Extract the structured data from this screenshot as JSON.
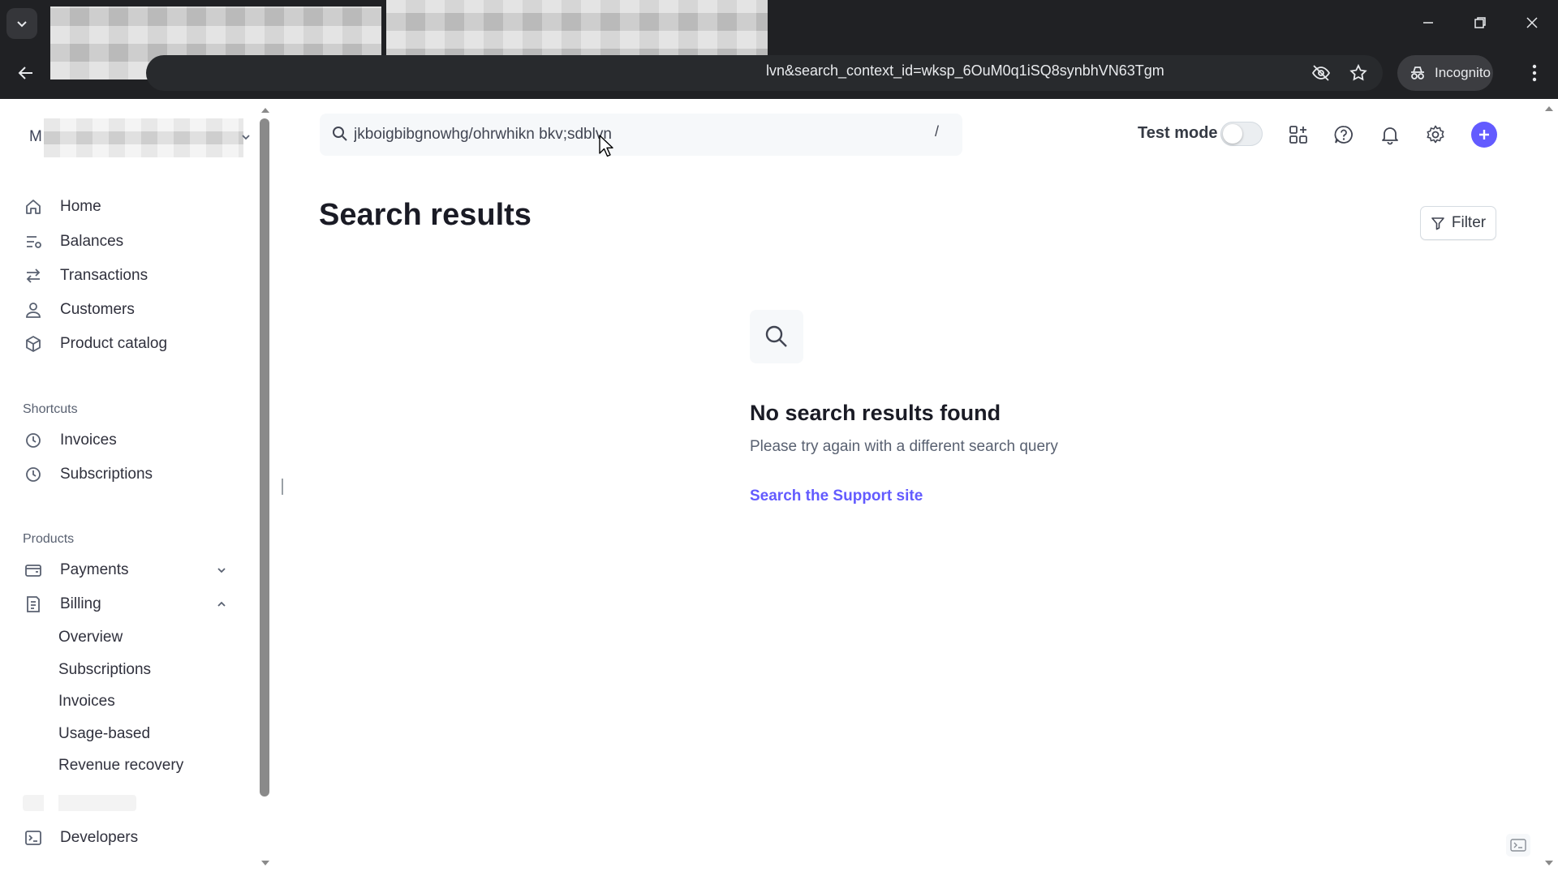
{
  "browser": {
    "url_visible": "lvn&search_context_id=wksp_6OuM0q1iSQ8synbhVN63Tgm",
    "incognito_label": "Incognito"
  },
  "account": {
    "initial": "M"
  },
  "sidebar": {
    "primary": [
      {
        "label": "Home",
        "icon": "home-icon"
      },
      {
        "label": "Balances",
        "icon": "balances-icon"
      },
      {
        "label": "Transactions",
        "icon": "transactions-icon"
      },
      {
        "label": "Customers",
        "icon": "customers-icon"
      },
      {
        "label": "Product catalog",
        "icon": "product-catalog-icon"
      }
    ],
    "shortcuts_label": "Shortcuts",
    "shortcuts": [
      {
        "label": "Invoices",
        "icon": "clock-icon"
      },
      {
        "label": "Subscriptions",
        "icon": "clock-icon"
      }
    ],
    "products_label": "Products",
    "payments_label": "Payments",
    "billing_label": "Billing",
    "billing_items": [
      "Overview",
      "Subscriptions",
      "Invoices",
      "Usage-based",
      "Revenue recovery"
    ],
    "developers_label": "Developers"
  },
  "topbar": {
    "search_value": "jkboigbibgnowhg/ohrwhikn bkv;sdblvn",
    "search_shortcut": "/",
    "test_mode_label": "Test mode",
    "test_mode_on": false
  },
  "main": {
    "title": "Search results",
    "filter_label": "Filter",
    "empty_title": "No search results found",
    "empty_subtitle": "Please try again with a different search query",
    "support_link": "Search the Support site"
  },
  "colors": {
    "accent": "#635bff",
    "chrome": "#202124"
  }
}
